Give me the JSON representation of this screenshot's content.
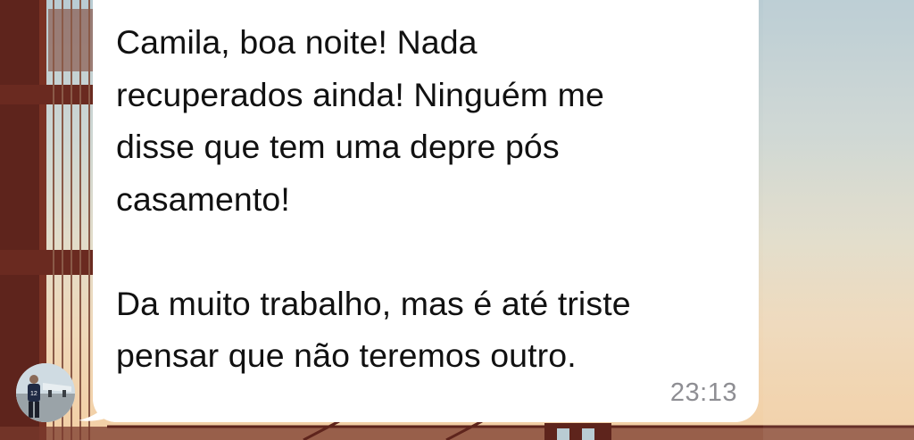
{
  "message": {
    "text": "Camila, boa noite! Nada\nrecuperados ainda! Ninguém me\ndisse que tem uma depre pós\ncasamento!\n\nDa muito trabalho, mas é até triste\npensar que não teremos outro.",
    "time": "23:13",
    "bubble_color": "#ffffff",
    "text_color": "#111111",
    "time_color": "#8e8e93"
  },
  "sender": {
    "avatar_icon": "person-avatar-icon"
  },
  "wallpaper": {
    "description_icon": "bridge-wallpaper-icon",
    "sky_color_top": "#b9ccd3",
    "sky_color_bottom": "#f3cfa4",
    "bridge_color": "#6a2a20"
  }
}
